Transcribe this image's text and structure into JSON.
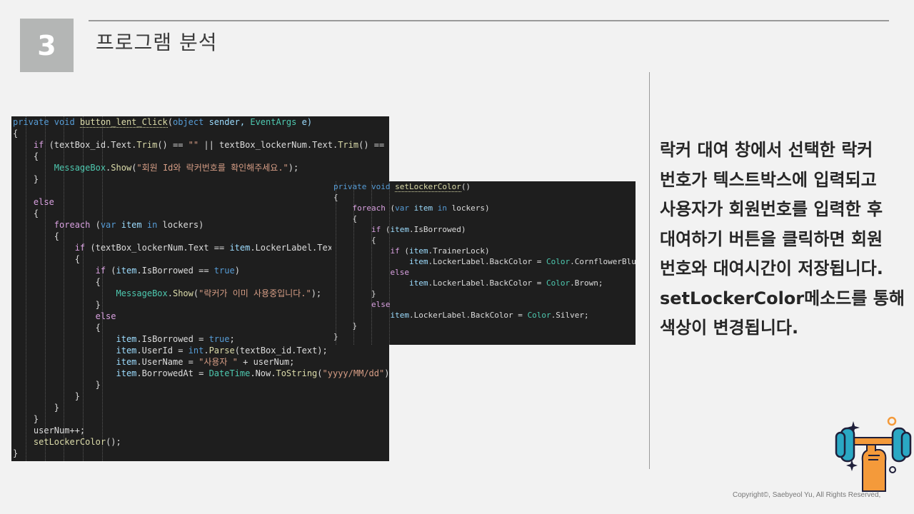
{
  "section": {
    "number": "3",
    "title": "프로그램 분석"
  },
  "code_main": {
    "lines": [
      [
        {
          "t": "private void ",
          "c": "kw"
        },
        {
          "t": "button_lent_Click",
          "c": "fn dt"
        },
        {
          "t": "(",
          "c": "pl"
        },
        {
          "t": "object ",
          "c": "kw"
        },
        {
          "t": "sender, ",
          "c": "prm"
        },
        {
          "t": "EventArgs ",
          "c": "ty"
        },
        {
          "t": "e)",
          "c": "prm"
        }
      ],
      [
        {
          "t": "{",
          "c": "pl"
        }
      ],
      [
        {
          "t": "    if ",
          "c": "cf"
        },
        {
          "t": "(textBox_id.Text.",
          "c": "pl"
        },
        {
          "t": "Trim",
          "c": "fn"
        },
        {
          "t": "() == ",
          "c": "pl"
        },
        {
          "t": "\"\"",
          "c": "str"
        },
        {
          "t": " || textBox_lockerNum.Text.",
          "c": "pl"
        },
        {
          "t": "Trim",
          "c": "fn"
        },
        {
          "t": "() == ",
          "c": "pl"
        },
        {
          "t": "\"\"",
          "c": "str"
        },
        {
          "t": ")",
          "c": "pl"
        }
      ],
      [
        {
          "t": "    {",
          "c": "pl"
        }
      ],
      [
        {
          "t": "        ",
          "c": "pl"
        },
        {
          "t": "MessageBox",
          "c": "ty"
        },
        {
          "t": ".",
          "c": "pl"
        },
        {
          "t": "Show",
          "c": "fn"
        },
        {
          "t": "(",
          "c": "pl"
        },
        {
          "t": "\"회원 Id와 락커번호를 확인해주세요.\"",
          "c": "str"
        },
        {
          "t": ");",
          "c": "pl"
        }
      ],
      [
        {
          "t": "    }",
          "c": "pl"
        }
      ],
      [
        {
          "t": "",
          "c": "pl"
        }
      ],
      [
        {
          "t": "    else",
          "c": "cf"
        }
      ],
      [
        {
          "t": "    {",
          "c": "pl"
        }
      ],
      [
        {
          "t": "        foreach ",
          "c": "cf"
        },
        {
          "t": "(",
          "c": "pl"
        },
        {
          "t": "var ",
          "c": "kw"
        },
        {
          "t": "item ",
          "c": "prm"
        },
        {
          "t": "in ",
          "c": "kw"
        },
        {
          "t": "lockers)",
          "c": "pl"
        }
      ],
      [
        {
          "t": "        {",
          "c": "pl"
        }
      ],
      [
        {
          "t": "            if ",
          "c": "cf"
        },
        {
          "t": "(textBox_lockerNum.Text == ",
          "c": "pl"
        },
        {
          "t": "item",
          "c": "prm"
        },
        {
          "t": ".LockerLabel.Text)",
          "c": "pl"
        }
      ],
      [
        {
          "t": "            {",
          "c": "pl"
        }
      ],
      [
        {
          "t": "                if ",
          "c": "cf"
        },
        {
          "t": "(",
          "c": "pl"
        },
        {
          "t": "item",
          "c": "prm"
        },
        {
          "t": ".IsBorrowed == ",
          "c": "pl"
        },
        {
          "t": "true",
          "c": "kw"
        },
        {
          "t": ")",
          "c": "pl"
        }
      ],
      [
        {
          "t": "                {",
          "c": "pl"
        }
      ],
      [
        {
          "t": "                    ",
          "c": "pl"
        },
        {
          "t": "MessageBox",
          "c": "ty"
        },
        {
          "t": ".",
          "c": "pl"
        },
        {
          "t": "Show",
          "c": "fn"
        },
        {
          "t": "(",
          "c": "pl"
        },
        {
          "t": "\"락커가 이미 사용중입니다.\"",
          "c": "str"
        },
        {
          "t": ");",
          "c": "pl"
        }
      ],
      [
        {
          "t": "                }",
          "c": "pl"
        }
      ],
      [
        {
          "t": "                else",
          "c": "cf"
        }
      ],
      [
        {
          "t": "                {",
          "c": "pl"
        }
      ],
      [
        {
          "t": "                    ",
          "c": "pl"
        },
        {
          "t": "item",
          "c": "prm"
        },
        {
          "t": ".IsBorrowed = ",
          "c": "pl"
        },
        {
          "t": "true",
          "c": "kw"
        },
        {
          "t": ";",
          "c": "pl"
        }
      ],
      [
        {
          "t": "                    ",
          "c": "pl"
        },
        {
          "t": "item",
          "c": "prm"
        },
        {
          "t": ".UserId = ",
          "c": "pl"
        },
        {
          "t": "int",
          "c": "kw"
        },
        {
          "t": ".",
          "c": "pl"
        },
        {
          "t": "Parse",
          "c": "fn"
        },
        {
          "t": "(textBox_id.Text);",
          "c": "pl"
        }
      ],
      [
        {
          "t": "                    ",
          "c": "pl"
        },
        {
          "t": "item",
          "c": "prm"
        },
        {
          "t": ".UserName = ",
          "c": "pl"
        },
        {
          "t": "\"사용자 \"",
          "c": "str"
        },
        {
          "t": " + userNum;",
          "c": "pl"
        }
      ],
      [
        {
          "t": "                    ",
          "c": "pl"
        },
        {
          "t": "item",
          "c": "prm"
        },
        {
          "t": ".BorrowedAt = ",
          "c": "pl"
        },
        {
          "t": "DateTime",
          "c": "ty"
        },
        {
          "t": ".Now.",
          "c": "pl"
        },
        {
          "t": "ToString",
          "c": "fn"
        },
        {
          "t": "(",
          "c": "pl"
        },
        {
          "t": "\"yyyy/MM/dd\"",
          "c": "str"
        },
        {
          "t": ");",
          "c": "pl"
        }
      ],
      [
        {
          "t": "                }",
          "c": "pl"
        }
      ],
      [
        {
          "t": "            }",
          "c": "pl"
        }
      ],
      [
        {
          "t": "        }",
          "c": "pl"
        }
      ],
      [
        {
          "t": "    }",
          "c": "pl"
        }
      ],
      [
        {
          "t": "    userNum++;",
          "c": "pl"
        }
      ],
      [
        {
          "t": "    ",
          "c": "pl"
        },
        {
          "t": "setLockerColor",
          "c": "fn"
        },
        {
          "t": "();",
          "c": "pl"
        }
      ],
      [
        {
          "t": "}",
          "c": "pl"
        }
      ]
    ]
  },
  "code_side": {
    "lines": [
      [
        {
          "t": "private void ",
          "c": "kw"
        },
        {
          "t": "setLockerColor",
          "c": "fn dt"
        },
        {
          "t": "()",
          "c": "pl"
        }
      ],
      [
        {
          "t": "{",
          "c": "pl"
        }
      ],
      [
        {
          "t": "    foreach ",
          "c": "cf"
        },
        {
          "t": "(",
          "c": "pl"
        },
        {
          "t": "var ",
          "c": "kw"
        },
        {
          "t": "item ",
          "c": "prm"
        },
        {
          "t": "in ",
          "c": "kw"
        },
        {
          "t": "lockers)",
          "c": "pl"
        }
      ],
      [
        {
          "t": "    {",
          "c": "pl"
        }
      ],
      [
        {
          "t": "        if ",
          "c": "cf"
        },
        {
          "t": "(",
          "c": "pl"
        },
        {
          "t": "item",
          "c": "prm"
        },
        {
          "t": ".IsBorrowed)",
          "c": "pl"
        }
      ],
      [
        {
          "t": "        {",
          "c": "pl"
        }
      ],
      [
        {
          "t": "            if ",
          "c": "cf"
        },
        {
          "t": "(",
          "c": "pl"
        },
        {
          "t": "item",
          "c": "prm"
        },
        {
          "t": ".TrainerLock)",
          "c": "pl"
        }
      ],
      [
        {
          "t": "                ",
          "c": "pl"
        },
        {
          "t": "item",
          "c": "prm"
        },
        {
          "t": ".LockerLabel.BackColor = ",
          "c": "pl"
        },
        {
          "t": "Color",
          "c": "ty"
        },
        {
          "t": ".CornflowerBlue;",
          "c": "pl"
        }
      ],
      [
        {
          "t": "            else",
          "c": "cf"
        }
      ],
      [
        {
          "t": "                ",
          "c": "pl"
        },
        {
          "t": "item",
          "c": "prm"
        },
        {
          "t": ".LockerLabel.BackColor = ",
          "c": "pl"
        },
        {
          "t": "Color",
          "c": "ty"
        },
        {
          "t": ".Brown;",
          "c": "pl"
        }
      ],
      [
        {
          "t": "        }",
          "c": "pl"
        }
      ],
      [
        {
          "t": "        else",
          "c": "cf"
        }
      ],
      [
        {
          "t": "            ",
          "c": "pl"
        },
        {
          "t": "item",
          "c": "prm"
        },
        {
          "t": ".LockerLabel.BackColor = ",
          "c": "pl"
        },
        {
          "t": "Color",
          "c": "ty"
        },
        {
          "t": ".Silver;",
          "c": "pl"
        }
      ],
      [
        {
          "t": "    }",
          "c": "pl"
        }
      ],
      [
        {
          "t": "}",
          "c": "pl"
        }
      ]
    ]
  },
  "description": {
    "lines": [
      "락커 대여 창에서 선택한 락커",
      "번호가 텍스트박스에 입력되고",
      "사용자가 회원번호를 입력한 후",
      "대여하기 버튼을 클릭하면 회원",
      "번호와 대여시간이 저장됩니다.",
      "setLockerColor메소드를 통해",
      "색상이 변경됩니다."
    ]
  },
  "copyright": "Copyright©, Saebyeol Yu, All Rights Reserved,",
  "icons": {
    "decoration": "dumbbell-icon"
  },
  "colors": {
    "code_bg": "#1e1e1e",
    "accent_orange": "#f49a3a",
    "dumbbell_teal": "#2aa8c4"
  }
}
